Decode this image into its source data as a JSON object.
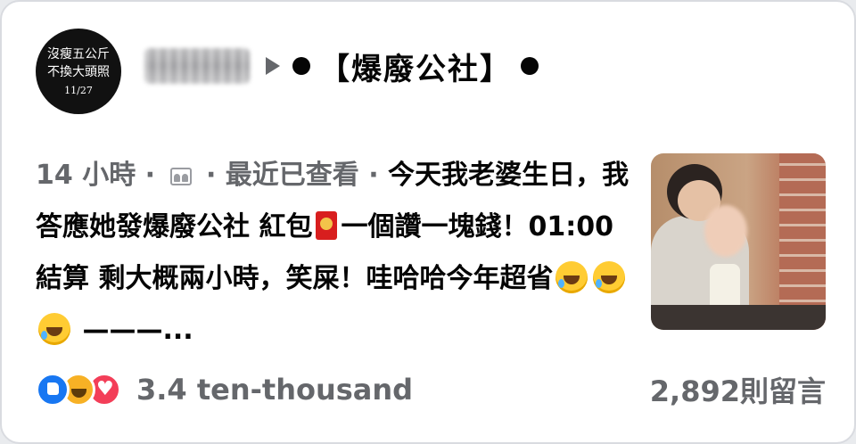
{
  "avatar": {
    "line1": "沒瘦五公斤",
    "line2": "不換大頭照",
    "line3": "11/27"
  },
  "header": {
    "group_name": "【爆廢公社】"
  },
  "post": {
    "time": "14 小時",
    "sep1": " · ",
    "sep2": " · ",
    "seen": "最近已查看",
    "sep3": " · ",
    "text_part1": "今天我老婆生日，我答應她發爆廢公社 紅包",
    "text_part2": "一個讚一塊錢！01:00結算 剩大概兩小時，笑屎！哇哈哈今年超省",
    "text_tail": " ———..."
  },
  "footer": {
    "reaction_count": "3.4 ten-thousand",
    "comment_count": "2,892則留言"
  },
  "icons": {
    "privacy": "friends-icon",
    "red_envelope": "red-envelope-icon",
    "laughing": "rolling-on-floor-laughing-icon",
    "reactions": [
      "like-icon",
      "haha-icon",
      "love-icon"
    ]
  },
  "colors": {
    "text": "#050505",
    "secondary": "#65676b",
    "like": "#1877f2",
    "love": "#f33e58",
    "haha": "#f7b125"
  }
}
